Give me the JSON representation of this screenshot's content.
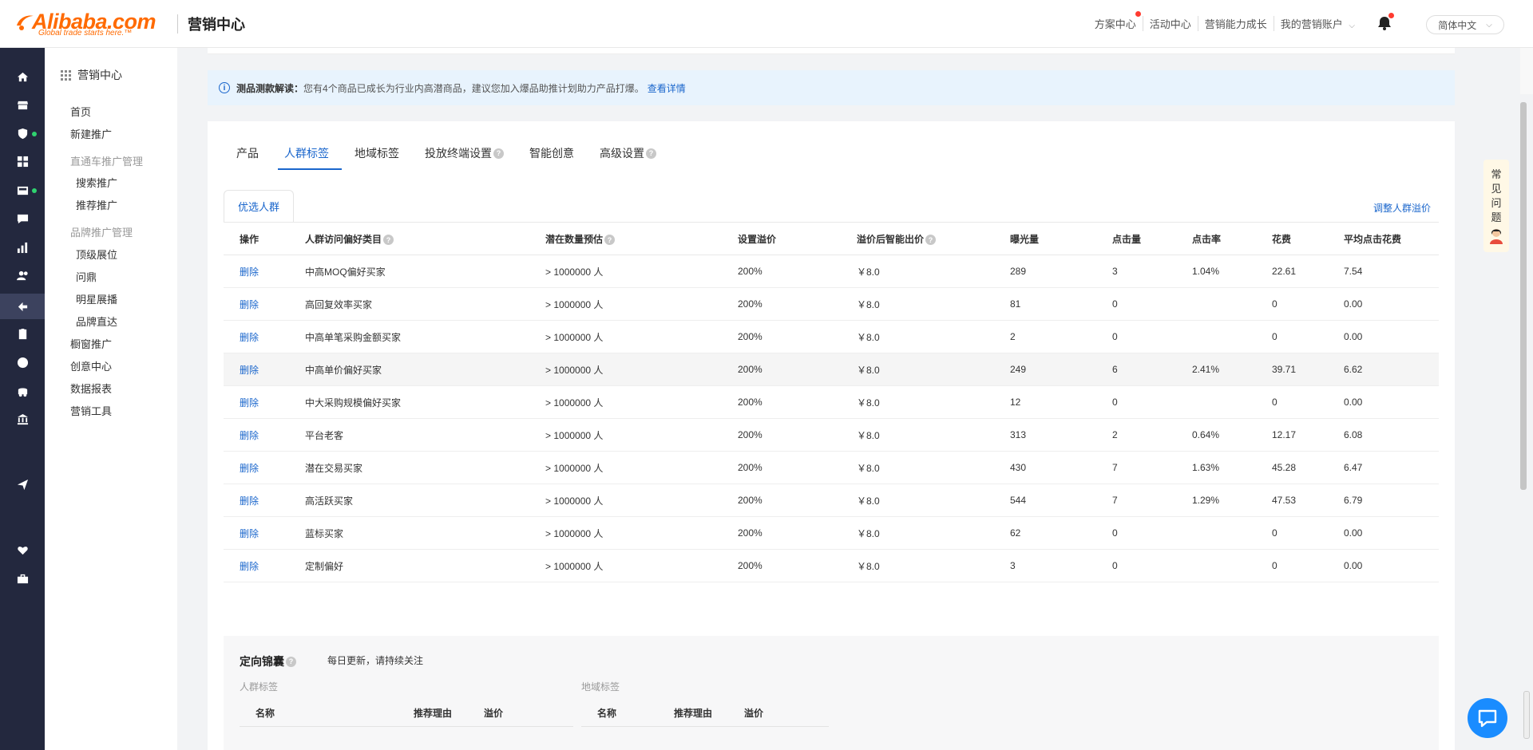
{
  "header": {
    "logo_text": "Alibaba.com",
    "logo_tagline": "Global trade starts here.™",
    "title": "营销中心",
    "nav": [
      {
        "label": "方案中心",
        "dot": true
      },
      {
        "label": "活动中心",
        "dot": false
      },
      {
        "label": "营销能力成长",
        "dot": false
      },
      {
        "label": "我的营销账户",
        "dot": false,
        "caret": "⌵"
      }
    ],
    "lang": "简体中文",
    "lang_caret": "⌵"
  },
  "rail_icons": [
    "home-icon",
    "store-icon",
    "shield-icon",
    "apps-icon",
    "inbox-icon",
    "message-icon",
    "chart-icon",
    "users-icon",
    "marketing-icon",
    "clipboard-icon",
    "globe-icon",
    "logistics-icon",
    "bank-icon",
    "send-icon",
    "heart-icon",
    "briefcase-icon"
  ],
  "sidebar": {
    "title": "营销中心",
    "items": [
      {
        "label": "首页",
        "type": "item"
      },
      {
        "label": "新建推广",
        "type": "item"
      },
      {
        "label": "直通车推广管理",
        "type": "header"
      },
      {
        "label": "搜索推广",
        "type": "sub"
      },
      {
        "label": "推荐推广",
        "type": "sub"
      },
      {
        "label": "品牌推广管理",
        "type": "header"
      },
      {
        "label": "顶级展位",
        "type": "sub"
      },
      {
        "label": "问鼎",
        "type": "sub"
      },
      {
        "label": "明星展播",
        "type": "sub"
      },
      {
        "label": "品牌直达",
        "type": "sub"
      },
      {
        "label": "橱窗推广",
        "type": "item"
      },
      {
        "label": "创意中心",
        "type": "item"
      },
      {
        "label": "数据报表",
        "type": "item"
      },
      {
        "label": "营销工具",
        "type": "item"
      }
    ]
  },
  "notice": {
    "icon_glyph": "i",
    "title": "测品测款解读：",
    "text": "您有4个商品已成长为行业内高潜商品，建议您加入爆品助推计划助力产品打爆。",
    "link": "查看详情"
  },
  "tabs": [
    {
      "label": "产品",
      "help": false
    },
    {
      "label": "人群标签",
      "help": false,
      "active": true
    },
    {
      "label": "地域标签",
      "help": false
    },
    {
      "label": "投放终端设置",
      "help": true
    },
    {
      "label": "智能创意",
      "help": false
    },
    {
      "label": "高级设置",
      "help": true
    }
  ],
  "help_glyph": "?",
  "subtab": "优选人群",
  "adjust_link": "调整人群溢价",
  "table": {
    "columns": [
      {
        "label": "操作",
        "help": false
      },
      {
        "label": "人群访问偏好类目",
        "help": true
      },
      {
        "label": "潜在数量预估",
        "help": true
      },
      {
        "label": "设置溢价",
        "help": false
      },
      {
        "label": "溢价后智能出价",
        "help": true
      },
      {
        "label": "曝光量",
        "help": false
      },
      {
        "label": "点击量",
        "help": false
      },
      {
        "label": "点击率",
        "help": false
      },
      {
        "label": "花费",
        "help": false
      },
      {
        "label": "平均点击花费",
        "help": false
      }
    ],
    "rows": [
      {
        "action": "删除",
        "name": "中高MOQ偏好买家",
        "potential": "> 1000000 人",
        "premium": "200%",
        "bid": "￥8.0",
        "impressions": "289",
        "clicks": "3",
        "ctr": "1.04%",
        "cost": "22.61",
        "cpc": "7.54"
      },
      {
        "action": "删除",
        "name": "高回复效率买家",
        "potential": "> 1000000 人",
        "premium": "200%",
        "bid": "￥8.0",
        "impressions": "81",
        "clicks": "0",
        "ctr": "",
        "cost": "0",
        "cpc": "0.00"
      },
      {
        "action": "删除",
        "name": "中高单笔采购金额买家",
        "potential": "> 1000000 人",
        "premium": "200%",
        "bid": "￥8.0",
        "impressions": "2",
        "clicks": "0",
        "ctr": "",
        "cost": "0",
        "cpc": "0.00"
      },
      {
        "action": "删除",
        "name": "中高单价偏好买家",
        "potential": "> 1000000 人",
        "premium": "200%",
        "bid": "￥8.0",
        "impressions": "249",
        "clicks": "6",
        "ctr": "2.41%",
        "cost": "39.71",
        "cpc": "6.62",
        "highlight": true
      },
      {
        "action": "删除",
        "name": "中大采购规模偏好买家",
        "potential": "> 1000000 人",
        "premium": "200%",
        "bid": "￥8.0",
        "impressions": "12",
        "clicks": "0",
        "ctr": "",
        "cost": "0",
        "cpc": "0.00"
      },
      {
        "action": "删除",
        "name": "平台老客",
        "potential": "> 1000000 人",
        "premium": "200%",
        "bid": "￥8.0",
        "impressions": "313",
        "clicks": "2",
        "ctr": "0.64%",
        "cost": "12.17",
        "cpc": "6.08"
      },
      {
        "action": "删除",
        "name": "潜在交易买家",
        "potential": "> 1000000 人",
        "premium": "200%",
        "bid": "￥8.0",
        "impressions": "430",
        "clicks": "7",
        "ctr": "1.63%",
        "cost": "45.28",
        "cpc": "6.47"
      },
      {
        "action": "删除",
        "name": "高活跃买家",
        "potential": "> 1000000 人",
        "premium": "200%",
        "bid": "￥8.0",
        "impressions": "544",
        "clicks": "7",
        "ctr": "1.29%",
        "cost": "47.53",
        "cpc": "6.79"
      },
      {
        "action": "删除",
        "name": "蓝标买家",
        "potential": "> 1000000 人",
        "premium": "200%",
        "bid": "￥8.0",
        "impressions": "62",
        "clicks": "0",
        "ctr": "",
        "cost": "0",
        "cpc": "0.00"
      },
      {
        "action": "删除",
        "name": "定制偏好",
        "potential": "> 1000000 人",
        "premium": "200%",
        "bid": "￥8.0",
        "impressions": "3",
        "clicks": "0",
        "ctr": "",
        "cost": "0",
        "cpc": "0.00"
      }
    ]
  },
  "lower": {
    "title": "定向锦囊",
    "note": "每日更新，请持续关注",
    "crowd_label": "人群标签",
    "region_label": "地域标签",
    "head": {
      "name": "名称",
      "reason": "推荐理由",
      "premium": "溢价"
    }
  },
  "faq": [
    "常",
    "见",
    "问",
    "题"
  ],
  "colors": {
    "accent": "#1a66cc",
    "brand": "#ff6a00",
    "rail": "#23283e",
    "notice_bg": "#e8f3fd"
  }
}
